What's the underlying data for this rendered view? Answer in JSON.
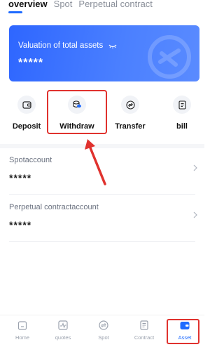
{
  "tabs": [
    {
      "label": "overview",
      "active": true
    },
    {
      "label": "Spot",
      "active": false
    },
    {
      "label": "Perpetual contract",
      "active": false
    }
  ],
  "card": {
    "title": "Valuation of total assets",
    "value": "*****",
    "icons": {
      "visibility": "eye-closed-icon",
      "watermark": "brand-logo-icon"
    },
    "gradient_colors": [
      "#2e66ff",
      "#5a8bff"
    ]
  },
  "actions": [
    {
      "label": "Deposit",
      "icon": "wallet-icon"
    },
    {
      "label": "Withdraw",
      "icon": "coins-icon"
    },
    {
      "label": "Transfer",
      "icon": "transfer-icon"
    },
    {
      "label": "bill",
      "icon": "bill-icon"
    }
  ],
  "accounts": [
    {
      "name": "Spotaccount",
      "value": "*****"
    },
    {
      "name": "Perpetual contractaccount",
      "value": "*****"
    }
  ],
  "bottom_nav": [
    {
      "label": "Home",
      "icon": "home-icon",
      "active": false
    },
    {
      "label": "quotes",
      "icon": "chart-icon",
      "active": false
    },
    {
      "label": "Spot",
      "icon": "spot-icon",
      "active": false
    },
    {
      "label": "Contract",
      "icon": "contract-icon",
      "active": false
    },
    {
      "label": "Asset",
      "icon": "wallet-icon",
      "active": true
    }
  ],
  "colors": {
    "accent": "#1f6bff",
    "highlight": "#e0322e"
  }
}
